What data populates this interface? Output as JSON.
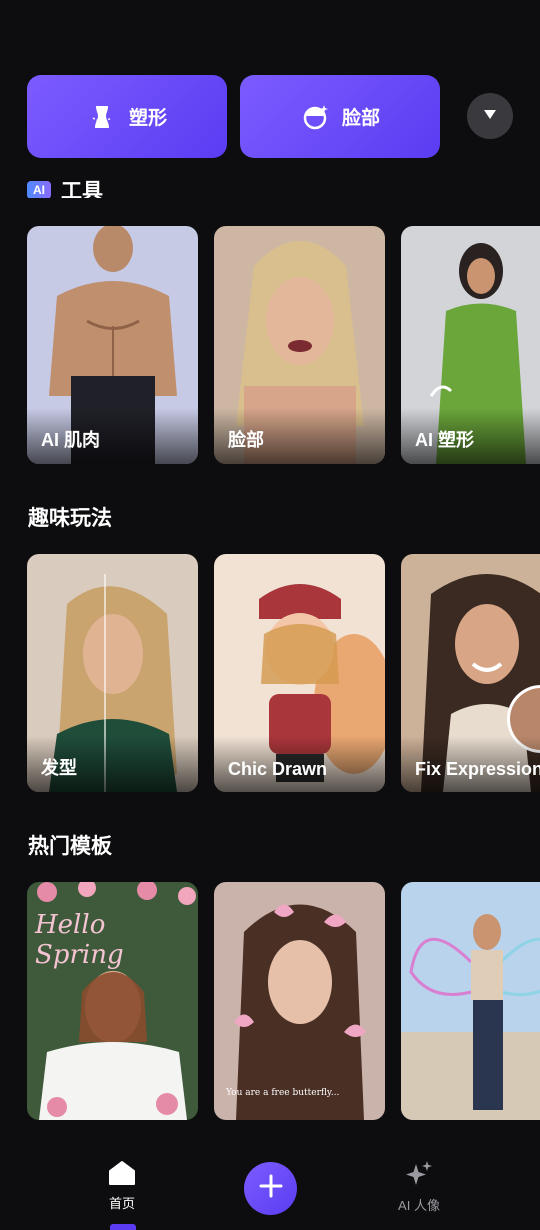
{
  "top_buttons": {
    "body_shape": {
      "label": "塑形",
      "icon": "body-icon"
    },
    "face": {
      "label": "脸部",
      "icon": "face-icon"
    },
    "expand_icon": "chevron-down-icon"
  },
  "clipped_section": {
    "badge": "AI",
    "title": "工具"
  },
  "sections": {
    "ai_tools": {
      "cards": [
        {
          "label": "AI 肌肉",
          "colors": [
            "#c9cde8",
            "#2a2a33"
          ]
        },
        {
          "label": "脸部",
          "colors": [
            "#d7b89a",
            "#6b4f3b"
          ]
        },
        {
          "label": "AI 塑形",
          "colors": [
            "#cfd2d6",
            "#6aa63a"
          ]
        }
      ]
    },
    "fun": {
      "title": "趣味玩法",
      "cards": [
        {
          "label": "发型",
          "colors": [
            "#d8c9bb",
            "#1f4d3a"
          ]
        },
        {
          "label": "Chic Drawn",
          "colors": [
            "#f3e3d6",
            "#a8363b"
          ]
        },
        {
          "label": "Fix Expression",
          "colors": [
            "#c9a98f",
            "#3b2a22"
          ]
        }
      ]
    },
    "templates": {
      "title": "热门模板",
      "cards": [
        {
          "caption": "Hello Spring",
          "colors": [
            "#3e5a3a",
            "#e58aa7"
          ]
        },
        {
          "caption": "You are a free butterfly...",
          "colors": [
            "#3a2a2a",
            "#f0a7c4"
          ]
        },
        {
          "caption": "",
          "colors": [
            "#b9d3ec",
            "#7a6a5a"
          ]
        }
      ]
    }
  },
  "bottom_nav": {
    "home": {
      "label": "首页",
      "icon": "home-icon"
    },
    "create": {
      "icon": "plus-icon"
    },
    "ai_portrait": {
      "label": "AI 人像",
      "icon": "sparkle-icon"
    }
  },
  "accent_color": "#6b4cf6"
}
